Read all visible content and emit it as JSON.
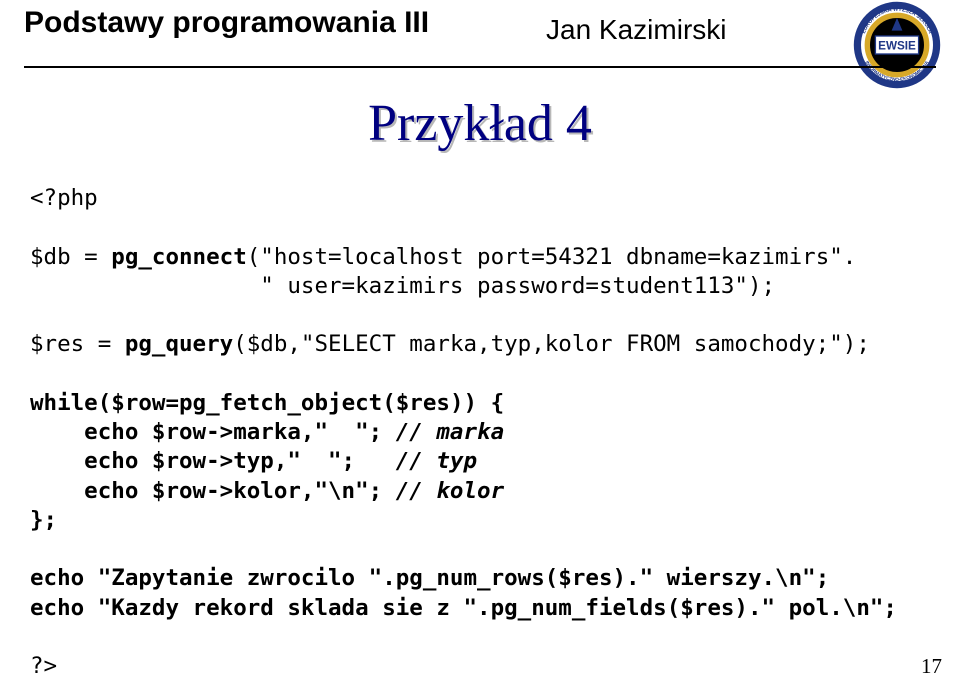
{
  "header": {
    "course": "Podstawy programowania III",
    "author": "Jan Kazimirski",
    "logo_text": "EWSIE",
    "logo_ring_top": "EUROPEJSKA WYŻSZA SZKOŁA",
    "logo_ring_bottom": "INFORMATYCZNO-EKONOMICZNA"
  },
  "title": "Przykład 4",
  "code": {
    "l1": "<?php",
    "l2_a": "$db = ",
    "l2_b": "pg_connect",
    "l2_c": "(\"host=localhost port=54321 dbname=kazimirs\".",
    "l3": "                 \" user=kazimirs password=student113\");",
    "l4_a": "$res = ",
    "l4_b": "pg_query",
    "l4_c": "($db,\"SELECT marka,typ,kolor FROM samochody;\");",
    "l5_a": "while($row=",
    "l5_b": "pg_fetch_object",
    "l5_c": "($res)) {",
    "l6_a": "    echo $row->marka,\"  \"; ",
    "l6_b": "// marka",
    "l7_a": "    echo $row->typ,\"  \";   ",
    "l7_b": "// typ",
    "l8_a": "    echo $row->kolor,\"\\n\"; ",
    "l8_b": "// kolor",
    "l9": "};",
    "l10_a": "echo \"Zapytanie zwrocilo \".",
    "l10_b": "pg_num_rows",
    "l10_c": "($res).\" wierszy.\\n\";",
    "l11_a": "echo \"Kazdy rekord sklada sie z \".",
    "l11_b": "pg_num_fields",
    "l11_c": "($res).\" pol.\\n\";",
    "l12": "?>"
  },
  "page_number": "17"
}
